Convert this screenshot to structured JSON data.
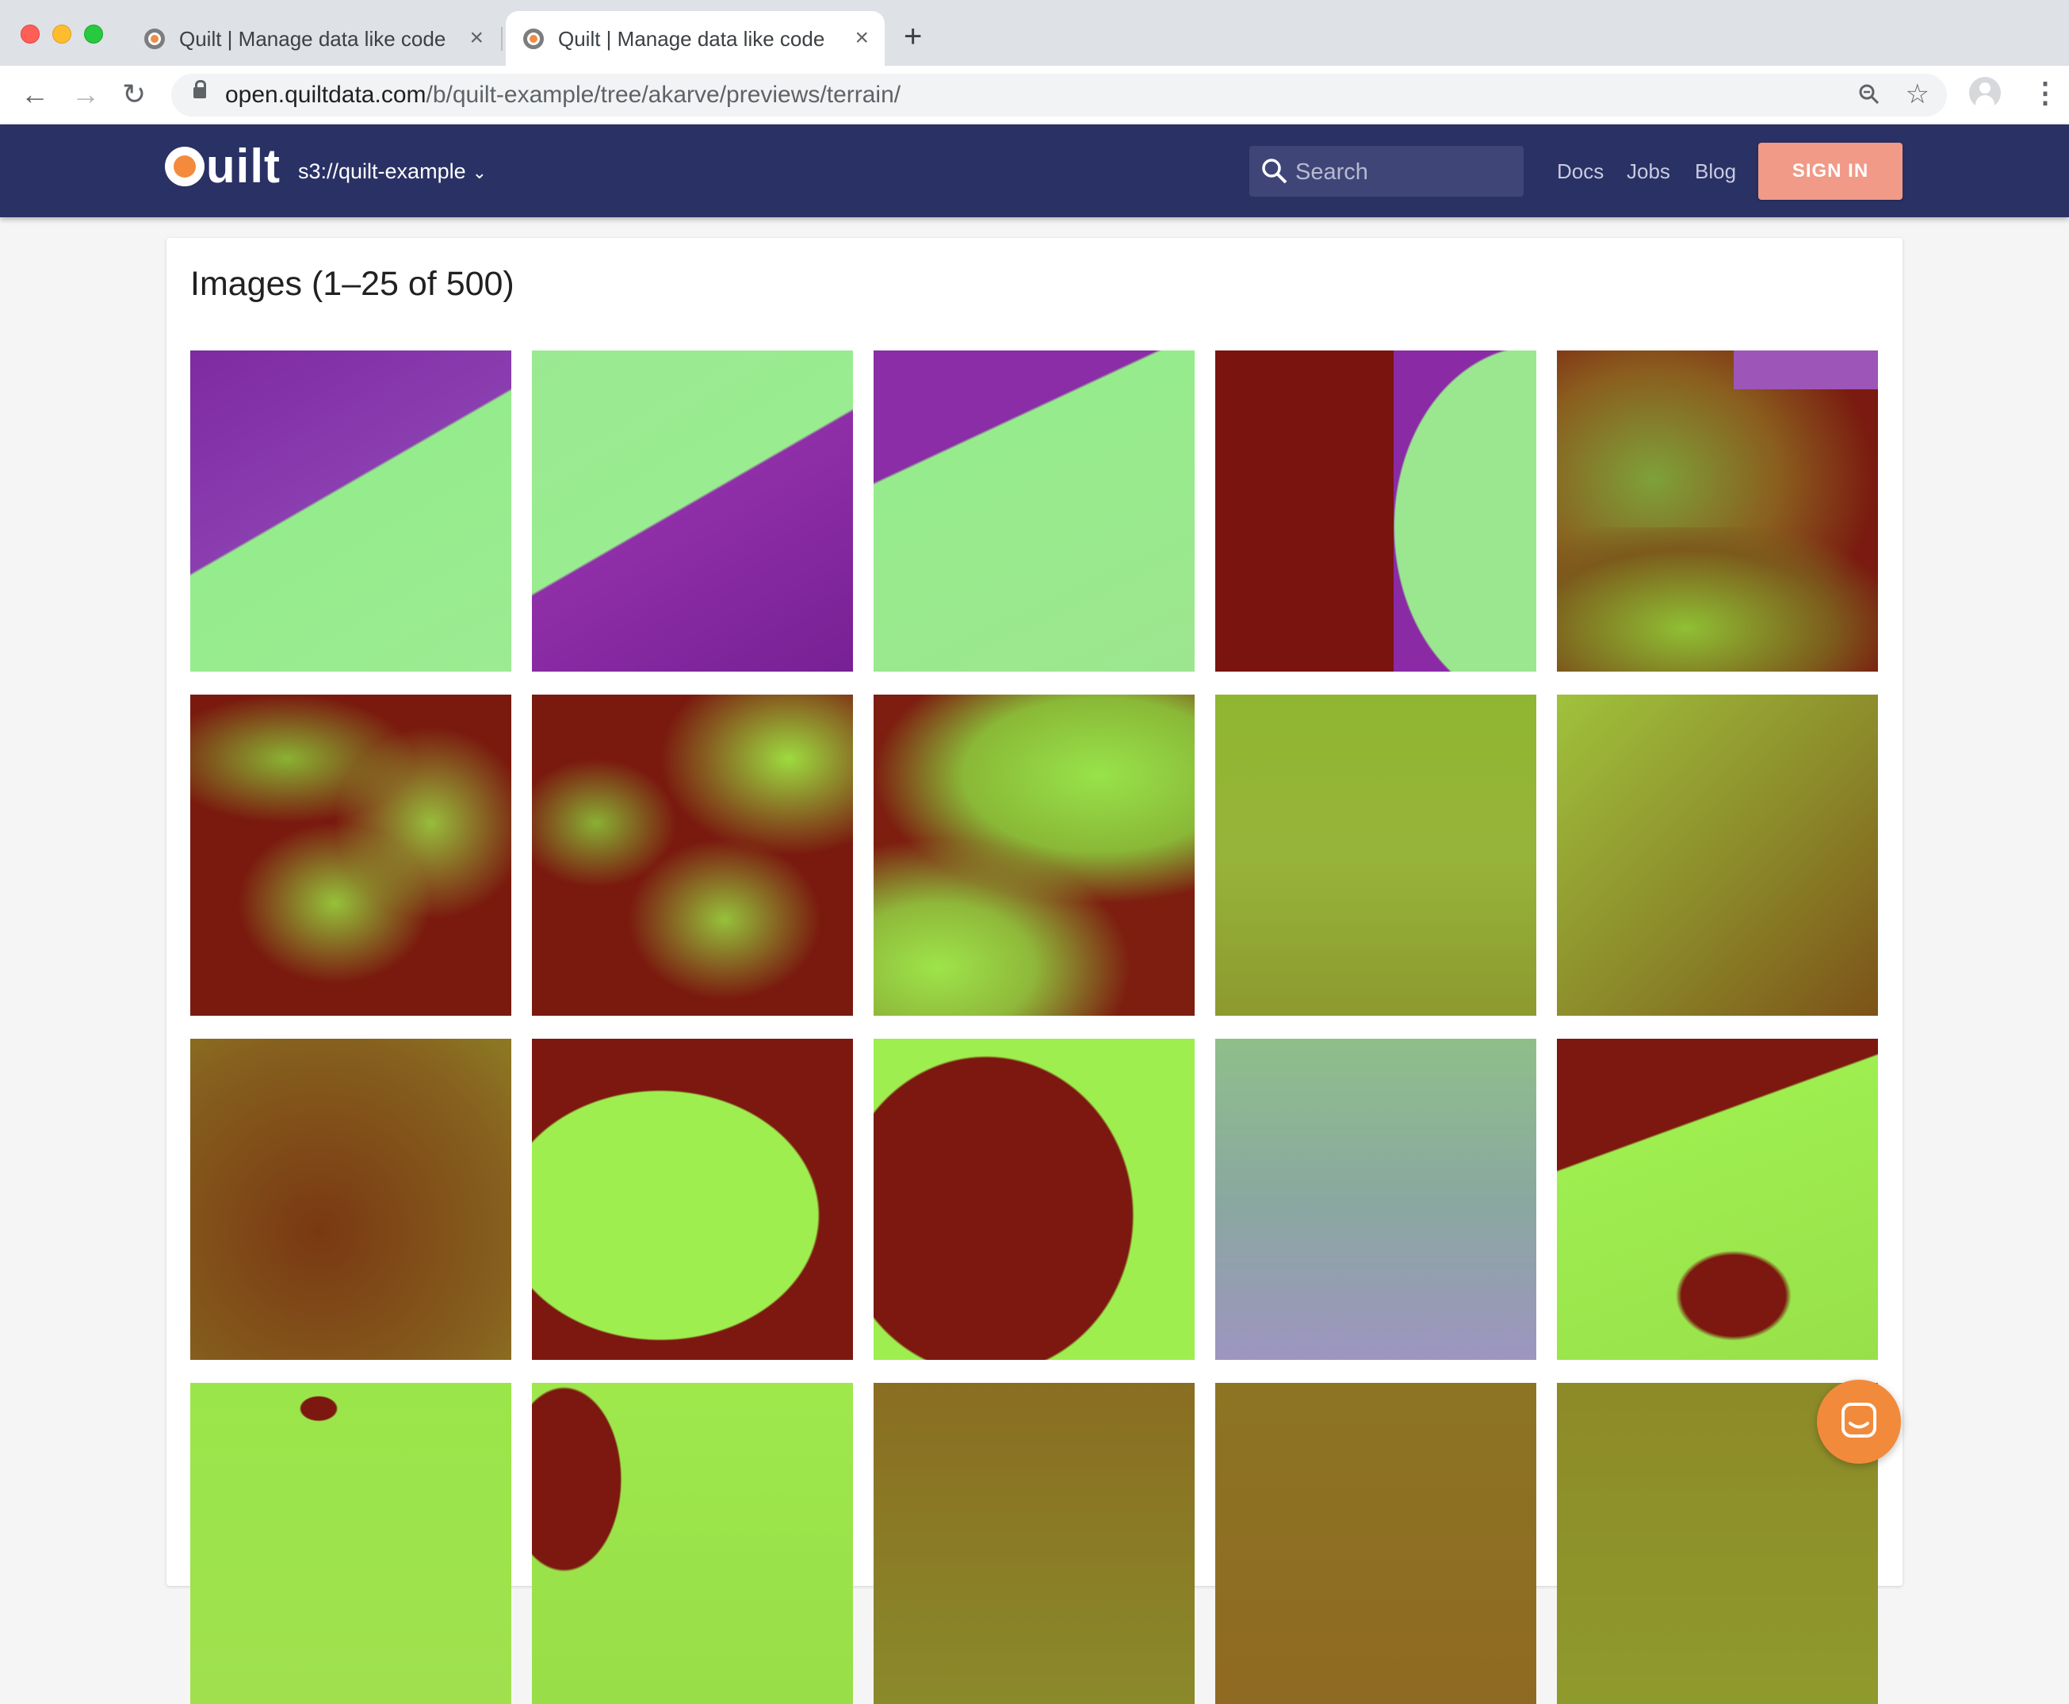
{
  "browser": {
    "tabs": [
      {
        "title": "Quilt | Manage data like code",
        "close": "×"
      },
      {
        "title": "Quilt | Manage data like code",
        "close": "×"
      }
    ],
    "new_tab": "+",
    "url_host": "open.quiltdata.com",
    "url_path": "/b/quilt-example/tree/akarve/previews/terrain/"
  },
  "header": {
    "logo_text": "uilt",
    "bucket": "s3://quilt-example",
    "search_placeholder": "Search",
    "nav": {
      "docs": "Docs",
      "jobs": "Jobs",
      "blog": "Blog"
    },
    "sign_in": "SIGN IN",
    "colors": {
      "appbar": "#2a3164",
      "sign_in": "#f09a87",
      "brand_orange": "#f38a3c"
    }
  },
  "main": {
    "heading": "Images (1–25 of 500)",
    "images": [
      "terrain-01",
      "terrain-02",
      "terrain-03",
      "terrain-04",
      "terrain-05",
      "terrain-06",
      "terrain-07",
      "terrain-08",
      "terrain-09",
      "terrain-10",
      "terrain-11",
      "terrain-12",
      "terrain-13",
      "terrain-14",
      "terrain-15",
      "terrain-16",
      "terrain-17",
      "terrain-18",
      "terrain-19",
      "terrain-20"
    ]
  },
  "icons": {
    "back": "arrow-left-icon",
    "forward": "arrow-right-icon",
    "reload": "reload-icon",
    "lock": "lock-icon",
    "zoom": "zoom-icon",
    "star": "star-icon",
    "profile": "profile-icon",
    "menu": "kebab-menu-icon",
    "search": "search-icon",
    "chat": "chat-icon"
  }
}
